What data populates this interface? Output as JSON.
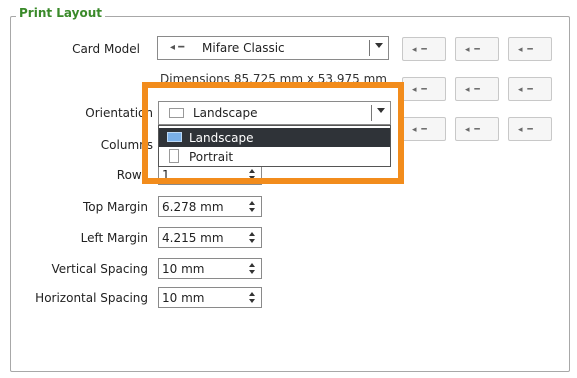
{
  "group_title": "Print Layout",
  "card_model": {
    "label": "Card Model",
    "value": "Mifare Classic",
    "icon": "card-chip-icon"
  },
  "dimensions_text": "Dimensions 85.725 mm x 53.975 mm",
  "orientation": {
    "label": "Orientation",
    "value": "Landscape",
    "options": [
      "Landscape",
      "Portrait"
    ]
  },
  "columns": {
    "label": "Columns"
  },
  "rows": {
    "label": "Rows",
    "value": "1"
  },
  "top_margin": {
    "label": "Top Margin",
    "value": "6.278 mm"
  },
  "left_margin": {
    "label": "Left Margin",
    "value": "4.215 mm"
  },
  "vertical_spacing": {
    "label": "Vertical Spacing",
    "value": "10 mm"
  },
  "horizontal_spacing": {
    "label": "Horizontal Spacing",
    "value": "10 mm"
  },
  "layout_buttons": [
    {
      "glyph": "◂ ━"
    },
    {
      "glyph": "◂ ━"
    },
    {
      "glyph": "◂ ━"
    },
    {
      "glyph": "◂ ━"
    },
    {
      "glyph": "◂ ━"
    },
    {
      "glyph": "◂ ━"
    },
    {
      "glyph": "◂ ━"
    },
    {
      "glyph": "◂ ━"
    },
    {
      "glyph": "◂ ━"
    }
  ],
  "colors": {
    "title": "#3a8a2a",
    "highlight": "#f28c1c",
    "selected_item": "#2f3338"
  }
}
